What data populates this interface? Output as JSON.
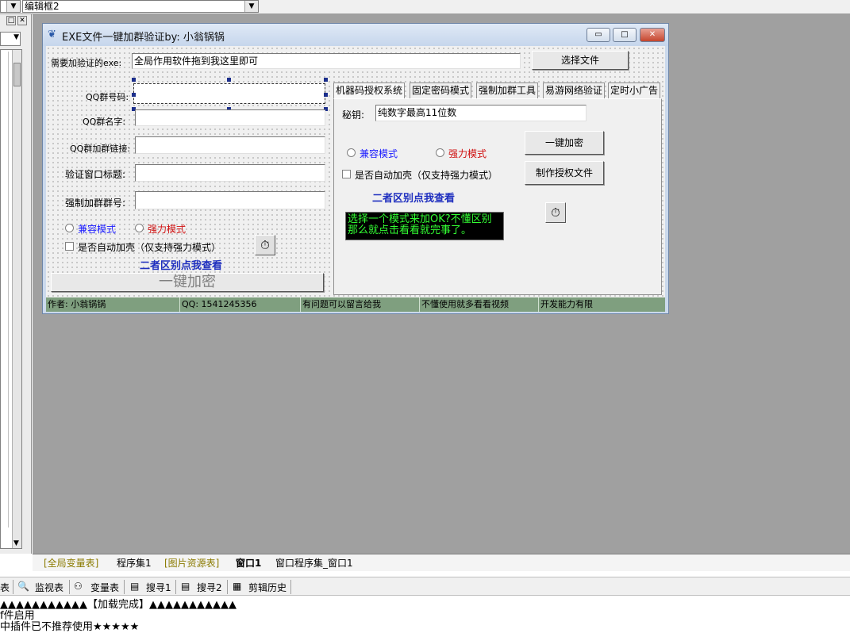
{
  "toolbar": {
    "left_combo_value": "",
    "combo_value": "编辑框2"
  },
  "window": {
    "title": "EXE文件一键加群验证by: 小翁锅锅",
    "min_glyph": "▭",
    "max_glyph": "□",
    "close_glyph": "✕"
  },
  "form": {
    "exe_label": "需要加验证的exe:",
    "exe_value": "全局作用软件拖到我这里即可",
    "choose_file": "选择文件",
    "qq_group_no_label": "QQ群号码:",
    "qq_group_name_label": "QQ群名字:",
    "qq_group_link_label": "QQ群加群链接:",
    "verify_title_label": "验证窗口标题:",
    "force_group_label": "强制加群群号:",
    "compat_mode": "兼容模式",
    "force_mode": "强力模式",
    "auto_shell": "是否自动加壳（仅支持强力模式）",
    "diff_link": "二者区别点我查看",
    "encrypt_button": "一键加密"
  },
  "tabs": [
    {
      "label": "机器码授权系统"
    },
    {
      "label": "固定密码模式"
    },
    {
      "label": "强制加群工具"
    },
    {
      "label": "易游网络验证"
    },
    {
      "label": "定时小广告"
    }
  ],
  "tab_panel": {
    "key_label": "秘钥:",
    "key_value": "纯数字最高11位数",
    "compat_mode": "兼容模式",
    "force_mode": "强力模式",
    "encrypt_button": "一键加密",
    "make_license_button": "制作授权文件",
    "auto_shell": "是否自动加壳（仅支持强力模式）",
    "diff_link": "二者区别点我查看",
    "hint_line1": "选择一个模式来加OK?不懂区别",
    "hint_line2": "那么就点击看看就完事了。"
  },
  "timer_glyph": "⏱",
  "statusbar": [
    {
      "text": "作者: 小翁锅锅"
    },
    {
      "text": "QQ: 1541245356"
    },
    {
      "text": "有问题可以留言给我"
    },
    {
      "text": "不懂使用就多看看视频"
    },
    {
      "text": "开发能力有限"
    }
  ],
  "bottom_tabs": [
    {
      "label": "[全局变量表]"
    },
    {
      "label": "程序集1"
    },
    {
      "label": "[图片资源表]"
    },
    {
      "label": "窗口1"
    },
    {
      "label": "窗口程序集_窗口1"
    }
  ],
  "bottom_tools": [
    {
      "label": "表"
    },
    {
      "label": "监视表"
    },
    {
      "label": "变量表"
    },
    {
      "label": "搜寻1"
    },
    {
      "label": "搜寻2"
    },
    {
      "label": "剪辑历史"
    }
  ],
  "output": {
    "line1": "▲▲▲▲▲▲▲▲▲▲▲【加载完成】▲▲▲▲▲▲▲▲▲▲▲",
    "line2": "f件启用",
    "line3": "中插件已不推荐使用★★★★★"
  },
  "colors": {
    "design_bg": "#a0a0a0",
    "status_bg": "#7f9f7f",
    "link_blue": "#1f2fbf",
    "radio_blue": "#1a1aff",
    "radio_red": "#d01010",
    "hint_bg": "#000000",
    "hint_fg": "#33ff33"
  }
}
